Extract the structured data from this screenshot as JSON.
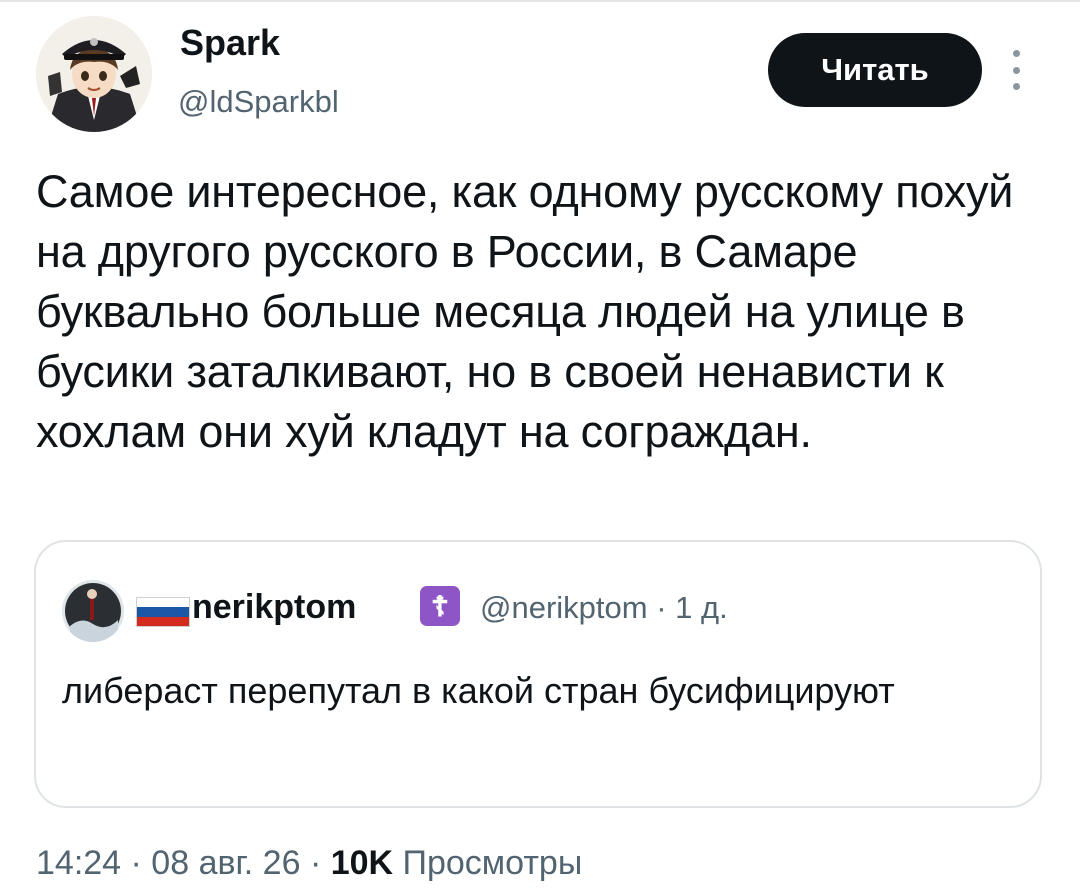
{
  "author": {
    "display_name": "Spark",
    "handle": "@ldSparkbl"
  },
  "follow_button": {
    "label": "Читать"
  },
  "tweet": {
    "text": "Самое интересное, как одному русскому похуй на другого русского в России, в Самаре буквально больше месяца людей на улице в бусики заталкивают, но в своей ненависти к хохлам они хуй кладут на сограждан."
  },
  "quote": {
    "name": "nerikptom",
    "badge": "☦",
    "meta": "@nerikptom · 1 д.",
    "text": "либераст перепутал в какой стран бусифицируют"
  },
  "footer": {
    "time_date": "14:24 · 08 авг. 26 ·",
    "views_count": "10K",
    "views_label": "Просмотры"
  },
  "icons": {
    "more": "more-vertical-icon",
    "flag": "russian-flag-icon"
  },
  "colors": {
    "text_primary": "#0f1419",
    "text_secondary": "#536471",
    "button_bg": "#0f1419",
    "badge_purple": "#8e55c7"
  }
}
